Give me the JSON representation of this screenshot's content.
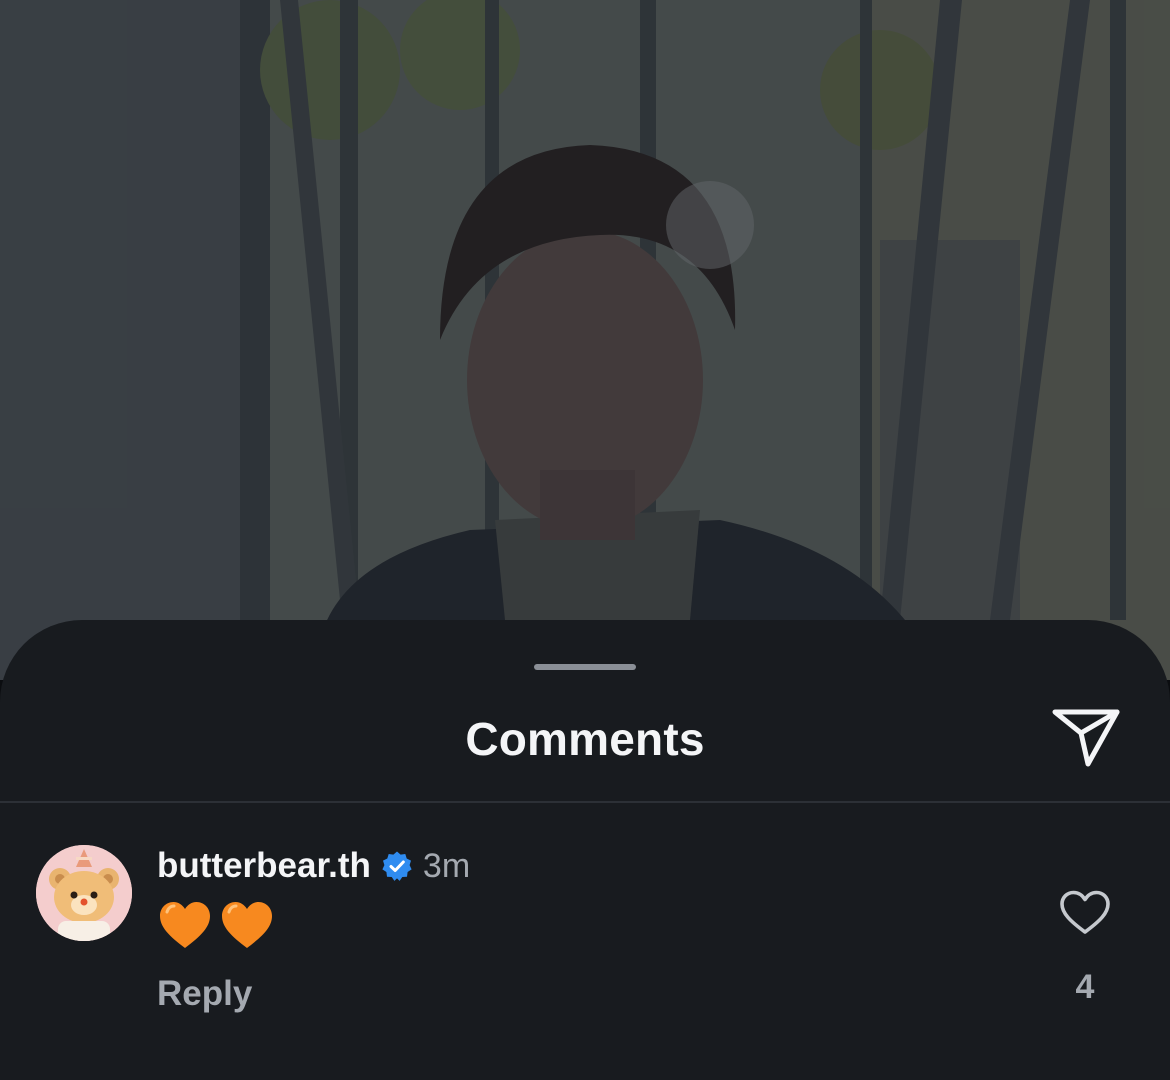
{
  "sheet": {
    "title": "Comments"
  },
  "comment": {
    "username": "butterbear.th",
    "timestamp": "3m",
    "text": "🧡🧡",
    "reply_label": "Reply",
    "like_count": "4"
  },
  "icons": {
    "share": "paper-plane-icon",
    "verified": "verified-badge-icon",
    "like": "heart-outline-icon",
    "emoji": "orange-heart-emoji"
  },
  "colors": {
    "sheet_background": "#181b1f",
    "text_primary": "#f4f5f7",
    "text_secondary": "#a4a9b0",
    "verified_blue": "#2f8cf0",
    "heart_orange": "#f7891f"
  }
}
